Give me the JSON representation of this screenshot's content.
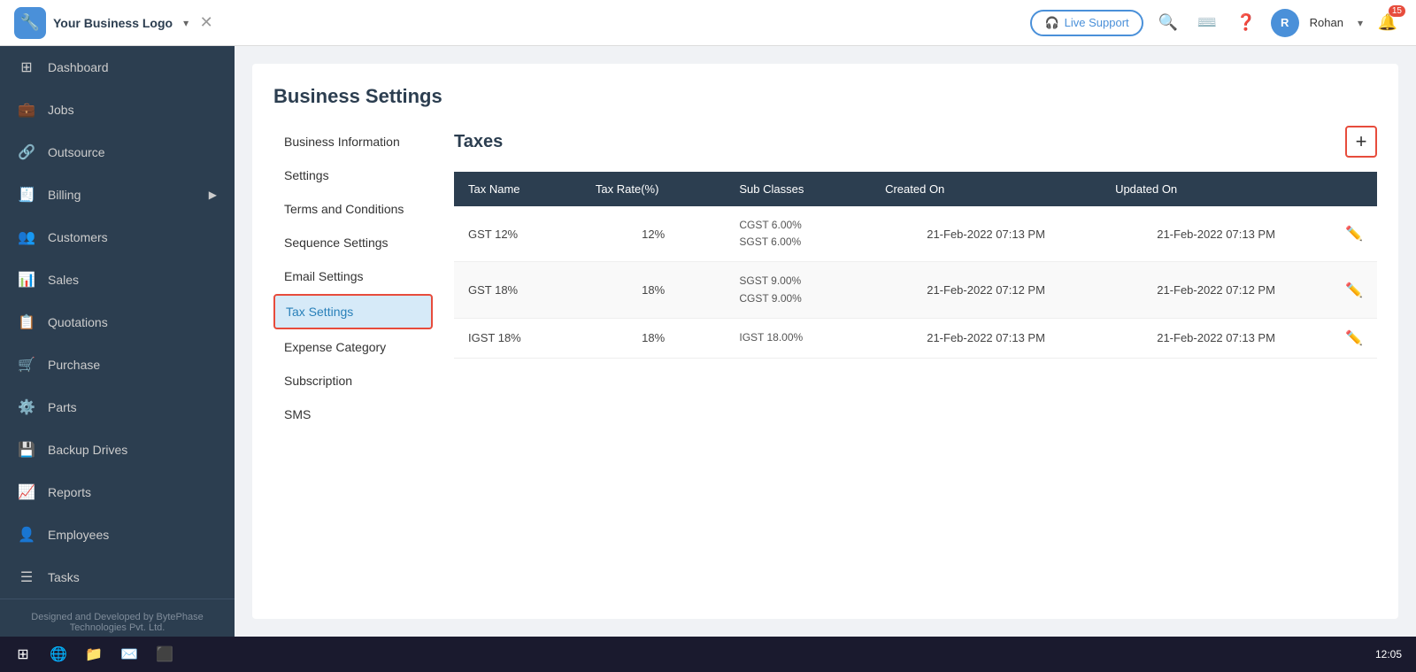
{
  "header": {
    "brand": "Your Business Logo",
    "live_support_label": "Live Support",
    "user_initial": "R",
    "user_name": "Rohan",
    "notification_count": "15"
  },
  "sidebar": {
    "items": [
      {
        "id": "dashboard",
        "label": "Dashboard",
        "icon": "⊞"
      },
      {
        "id": "jobs",
        "label": "Jobs",
        "icon": "💼"
      },
      {
        "id": "outsource",
        "label": "Outsource",
        "icon": "🔗"
      },
      {
        "id": "billing",
        "label": "Billing",
        "icon": "🧾",
        "has_arrow": true
      },
      {
        "id": "customers",
        "label": "Customers",
        "icon": "👥"
      },
      {
        "id": "sales",
        "label": "Sales",
        "icon": "📊"
      },
      {
        "id": "quotations",
        "label": "Quotations",
        "icon": "📋"
      },
      {
        "id": "purchase",
        "label": "Purchase",
        "icon": "🛒"
      },
      {
        "id": "parts",
        "label": "Parts",
        "icon": "⚙️"
      },
      {
        "id": "backup-drives",
        "label": "Backup Drives",
        "icon": "💾"
      },
      {
        "id": "reports",
        "label": "Reports",
        "icon": "📈"
      },
      {
        "id": "employees",
        "label": "Employees",
        "icon": "👤"
      },
      {
        "id": "tasks",
        "label": "Tasks",
        "icon": "☰"
      }
    ],
    "footer": "Designed and Developed by BytePhase\nTechnologies Pvt. Ltd."
  },
  "settings": {
    "title": "Business Settings",
    "menu_items": [
      {
        "id": "business-info",
        "label": "Business Information"
      },
      {
        "id": "settings",
        "label": "Settings"
      },
      {
        "id": "terms",
        "label": "Terms and Conditions"
      },
      {
        "id": "sequence",
        "label": "Sequence Settings"
      },
      {
        "id": "email",
        "label": "Email Settings"
      },
      {
        "id": "tax",
        "label": "Tax Settings",
        "active": true
      },
      {
        "id": "expense",
        "label": "Expense Category"
      },
      {
        "id": "subscription",
        "label": "Subscription"
      },
      {
        "id": "sms",
        "label": "SMS"
      }
    ]
  },
  "taxes": {
    "title": "Taxes",
    "add_button_label": "+",
    "table": {
      "headers": [
        "Tax Name",
        "Tax Rate(%)",
        "Sub Classes",
        "Created On",
        "Updated On",
        ""
      ],
      "rows": [
        {
          "name": "GST 12%",
          "rate": "12%",
          "sub_classes": "CGST 6.00%\nSGST 6.00%",
          "created_on": "21-Feb-2022 07:13 PM",
          "updated_on": "21-Feb-2022 07:13 PM"
        },
        {
          "name": "GST 18%",
          "rate": "18%",
          "sub_classes": "SGST 9.00%\nCGST 9.00%",
          "created_on": "21-Feb-2022 07:12 PM",
          "updated_on": "21-Feb-2022 07:12 PM"
        },
        {
          "name": "IGST 18%",
          "rate": "18%",
          "sub_classes": "IGST 18.00%",
          "created_on": "21-Feb-2022 07:13 PM",
          "updated_on": "21-Feb-2022 07:13 PM"
        }
      ]
    }
  },
  "taskbar": {
    "time": "12:05"
  }
}
